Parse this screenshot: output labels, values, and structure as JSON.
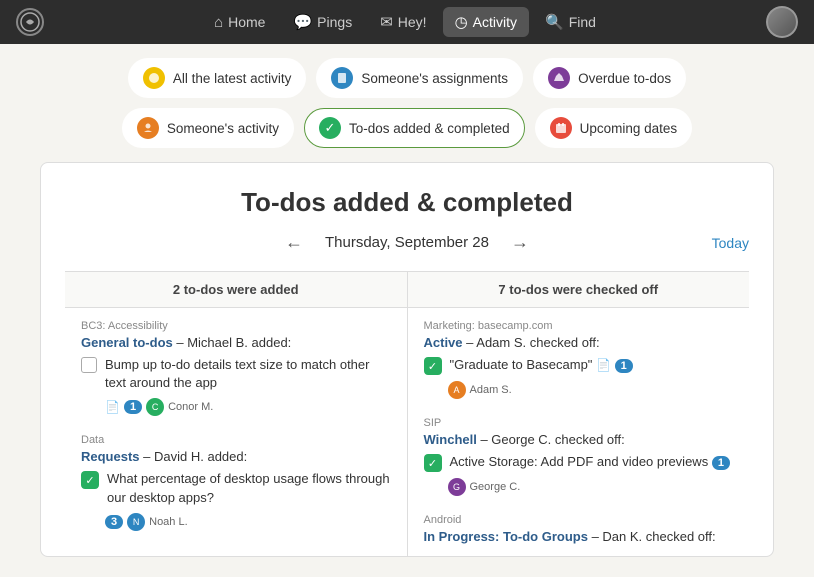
{
  "nav": {
    "items": [
      {
        "id": "home",
        "label": "Home",
        "icon": "⌂",
        "active": false
      },
      {
        "id": "pings",
        "label": "Pings",
        "icon": "💬",
        "active": false
      },
      {
        "id": "hey",
        "label": "Hey!",
        "icon": "✉",
        "active": false
      },
      {
        "id": "activity",
        "label": "Activity",
        "icon": "◷",
        "active": true
      },
      {
        "id": "find",
        "label": "Find",
        "icon": "🔍",
        "active": false
      }
    ]
  },
  "filter": {
    "items": [
      {
        "id": "all-latest",
        "label": "All the latest activity",
        "icon": "●",
        "iconClass": "icon-yellow",
        "selected": false
      },
      {
        "id": "someones-assignments",
        "label": "Someone's assignments",
        "icon": "📋",
        "iconClass": "icon-blue",
        "selected": false
      },
      {
        "id": "overdue-todos",
        "label": "Overdue to-dos",
        "icon": "🔔",
        "iconClass": "icon-purple",
        "selected": false
      },
      {
        "id": "someones-activity",
        "label": "Someone's activity",
        "icon": "👤",
        "iconClass": "icon-orange",
        "selected": false
      },
      {
        "id": "todos-added",
        "label": "To-dos added & completed",
        "icon": "✓",
        "iconClass": "icon-green",
        "selected": true
      },
      {
        "id": "upcoming-dates",
        "label": "Upcoming dates",
        "icon": "📅",
        "iconClass": "icon-red",
        "selected": false
      }
    ]
  },
  "main": {
    "title": "To-dos added & completed",
    "date": "Thursday, September 28",
    "today_link": "Today",
    "col_added": "2 to-dos were added",
    "col_checked": "7 to-dos were checked off",
    "added_section1": {
      "project": "BC3: Accessibility",
      "link_text": "General to-dos",
      "added_by": "– Michael B. added:",
      "todo_text": "Bump up to-do details text size to match other text around the app",
      "meta_badge": "1",
      "meta_user": "Conor M."
    },
    "added_section2": {
      "project": "Data",
      "link_text": "Requests",
      "added_by": "– David H. added:",
      "todo_text": "What percentage of desktop usage flows through our desktop apps?",
      "meta_badge": "3",
      "meta_user": "Noah L."
    },
    "checked_section1": {
      "project": "Marketing: basecamp.com",
      "link_text": "Active",
      "checked_by": "– Adam S. checked off:",
      "todo_text": "\"Graduate to Basecamp\"",
      "badge": "1",
      "meta_user": "Adam S."
    },
    "checked_section2": {
      "project": "SIP",
      "link_text": "Winchell",
      "checked_by": "– George C. checked off:",
      "todo_text": "Active Storage: Add PDF and video previews",
      "badge": "1",
      "meta_user": "George C."
    },
    "checked_section3": {
      "project": "Android",
      "link_text": "In Progress: To-do Groups",
      "checked_by": "– Dan K. checked off:"
    }
  }
}
